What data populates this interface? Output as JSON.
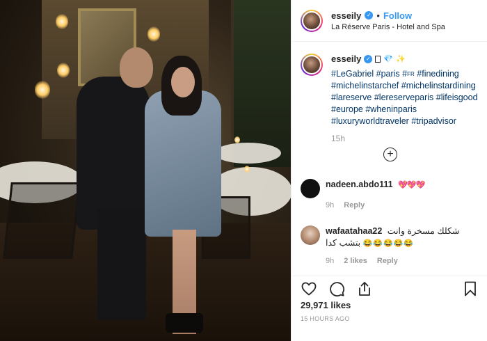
{
  "post": {
    "username": "esseily",
    "follow_label": "Follow",
    "location": "La Réserve Paris - Hotel and Spa",
    "dot": "•"
  },
  "caption": {
    "username": "esseily",
    "hashtags_lines": [
      "#LeGabriel #paris #",
      "#michelinstarchef #michelinstardining",
      "#lareserve #lereserveparis #lifeisgood",
      "#europe #wheninparis",
      "#luxuryworldtraveler #tripadvisor"
    ],
    "fr_flag": "FR",
    "finedining": "#finedining",
    "time": "15h"
  },
  "comments": [
    {
      "username": "nadeen.abdo111",
      "text": "💖💖💖",
      "time": "9h",
      "reply_label": "Reply",
      "avatar_color": "#111111"
    },
    {
      "username": "wafaatahaa22",
      "text_line1": "شكلك مسخرة وانت",
      "text_line2": "بتشب كدا",
      "emoji": "😂😂😂😂😂",
      "time": "9h",
      "likes": "2 likes",
      "reply_label": "Reply"
    }
  ],
  "engagement": {
    "likes": "29,971 likes",
    "timestamp": "15 HOURS AGO"
  },
  "icons": [
    "heart-icon",
    "comment-icon",
    "share-icon",
    "bookmark-icon",
    "add-comment-icon",
    "verified-badge-icon"
  ],
  "colors": {
    "link": "#3897f0",
    "hashtag": "#003569",
    "muted": "#999999",
    "text": "#262626",
    "divider": "#efefef"
  }
}
